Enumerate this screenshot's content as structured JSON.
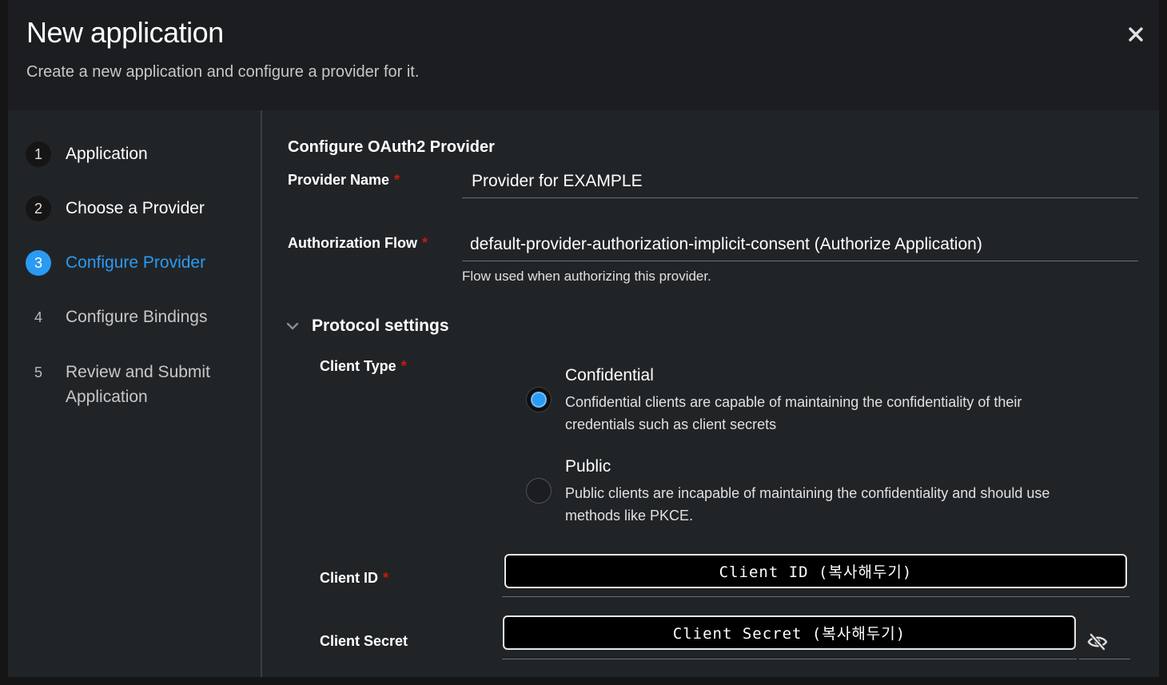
{
  "header": {
    "title": "New application",
    "subtitle": "Create a new application and configure a provider for it."
  },
  "nav": {
    "steps": [
      {
        "number": "1",
        "label": "Application",
        "state": "done"
      },
      {
        "number": "2",
        "label": "Choose a Provider",
        "state": "done"
      },
      {
        "number": "3",
        "label": "Configure Provider",
        "state": "current"
      },
      {
        "number": "4",
        "label": "Configure Bindings",
        "state": "future"
      },
      {
        "number": "5",
        "label": "Review and Submit Application",
        "state": "future"
      }
    ]
  },
  "form": {
    "section_title": "Configure OAuth2 Provider",
    "required_mark": "*",
    "provider_name": {
      "label": "Provider Name",
      "value": "Provider for EXAMPLE"
    },
    "authorization_flow": {
      "label": "Authorization Flow",
      "value": "default-provider-authorization-implicit-consent (Authorize Application)",
      "helper": "Flow used when authorizing this provider."
    },
    "protocol_settings": {
      "label": "Protocol settings",
      "expanded": true,
      "client_type": {
        "label": "Client Type",
        "options": [
          {
            "title": "Confidential",
            "description": "Confidential clients are capable of maintaining the confidentiality of their credentials such as client secrets",
            "selected": true
          },
          {
            "title": "Public",
            "description": "Public clients are incapable of maintaining the confidentiality and should use methods like PKCE.",
            "selected": false
          }
        ]
      },
      "client_id": {
        "label": "Client ID",
        "value": "Client ID (복사해두기)"
      },
      "client_secret": {
        "label": "Client Secret",
        "value": "Client Secret (복사해두기)"
      }
    }
  },
  "colors": {
    "accent": "#2b9af3",
    "required": "#c9190b",
    "background": "#212427"
  },
  "icons": {
    "close": "close-icon",
    "expand": "chevron-down-icon",
    "visibility": "eye-slash-icon"
  }
}
